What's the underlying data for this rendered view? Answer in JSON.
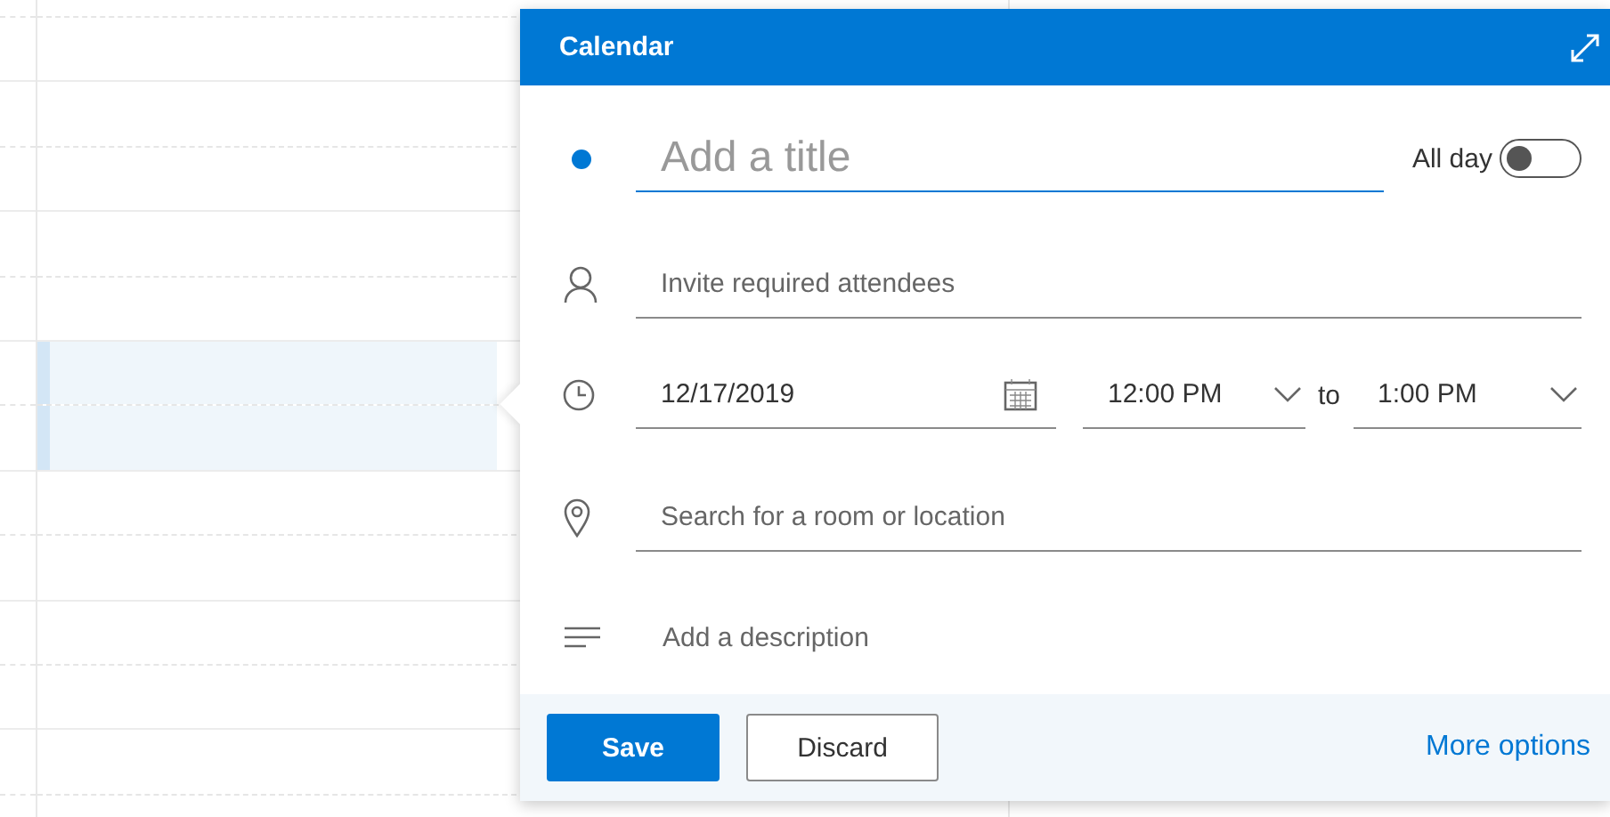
{
  "calendar_grid": {
    "slots": [
      {
        "selected": false
      },
      {
        "selected": false
      },
      {
        "selected": false
      },
      {
        "selected": false
      },
      {
        "selected": false
      },
      {
        "selected": true
      },
      {
        "selected": true
      },
      {
        "selected": false
      },
      {
        "selected": false
      },
      {
        "selected": false
      },
      {
        "selected": false
      },
      {
        "selected": false
      },
      {
        "selected": false
      }
    ]
  },
  "popup": {
    "title": "Calendar",
    "event_title": {
      "placeholder": "Add a title"
    },
    "all_day": {
      "label": "All day",
      "on": false
    },
    "attendees": {
      "placeholder": "Invite required attendees"
    },
    "date": {
      "value": "12/17/2019"
    },
    "start_time": {
      "value": "12:00 PM"
    },
    "to_label": "to",
    "end_time": {
      "value": "1:00 PM"
    },
    "location": {
      "placeholder": "Search for a room or location"
    },
    "description": {
      "placeholder": "Add a description"
    },
    "buttons": [
      {
        "label": "Save",
        "kind": "primary"
      },
      {
        "label": "Discard",
        "kind": "secondary"
      }
    ],
    "more_options": "More options"
  }
}
